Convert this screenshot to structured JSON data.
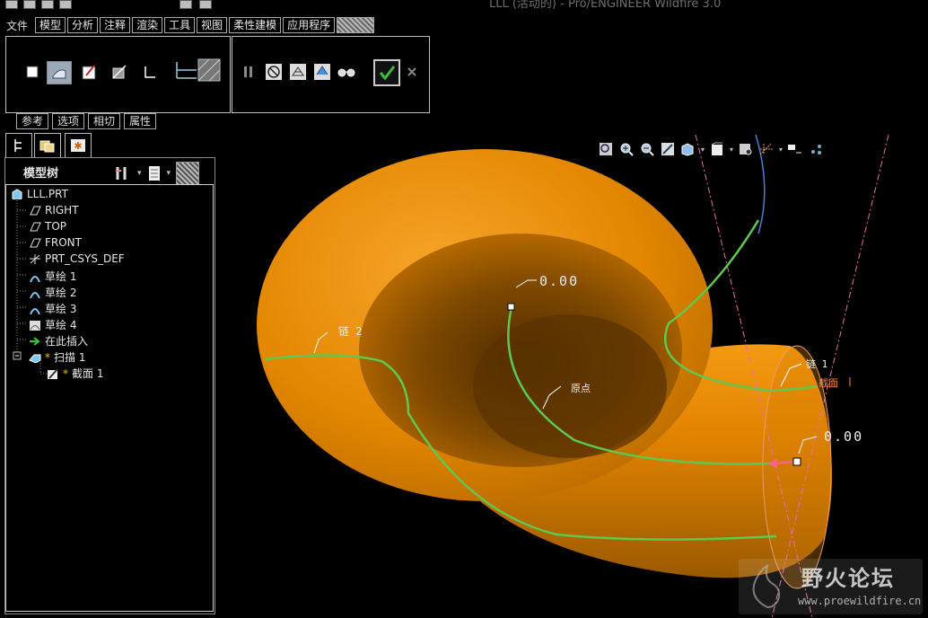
{
  "window": {
    "title_fragment": "LLL (活动的) - Pro/ENGINEER Wildfire 3.0"
  },
  "menu": {
    "file": "文件",
    "items": [
      "模型",
      "分析",
      "注释",
      "渲染",
      "工具",
      "视图",
      "柔性建模",
      "应用程序"
    ]
  },
  "dashboard": {
    "tabs": [
      "参考",
      "选项",
      "相切",
      "属性"
    ],
    "left_icons": [
      "solid-icon",
      "surface-icon",
      "sketch-icon",
      "remove-material-icon",
      "thin-icon",
      "section-trajectory-icon"
    ],
    "right_icons": [
      "pause-icon",
      "no-preview-icon",
      "geometry-preview-icon",
      "verify-icon",
      "glasses-icon",
      "confirm-check-icon",
      "cancel-x-icon"
    ]
  },
  "panel": {
    "header": "模型树",
    "tree": [
      {
        "label": "LLL.PRT",
        "icon": "part-icon",
        "level": 0
      },
      {
        "label": "RIGHT",
        "icon": "datum-plane-icon",
        "level": 1
      },
      {
        "label": "TOP",
        "icon": "datum-plane-icon",
        "level": 1
      },
      {
        "label": "FRONT",
        "icon": "datum-plane-icon",
        "level": 1
      },
      {
        "label": "PRT_CSYS_DEF",
        "icon": "csys-icon",
        "level": 1
      },
      {
        "label": "草绘 1",
        "icon": "sketch-feature-icon",
        "level": 1
      },
      {
        "label": "草绘 2",
        "icon": "sketch-feature-icon",
        "level": 1
      },
      {
        "label": "草绘 3",
        "icon": "sketch-feature-icon",
        "level": 1
      },
      {
        "label": "草绘 4",
        "icon": "sketch-feature-icon",
        "level": 1
      },
      {
        "label": "在此插入",
        "icon": "insert-here-icon",
        "level": 1
      },
      {
        "label": "扫描 1",
        "icon": "sweep-icon",
        "level": 1,
        "expanded": true,
        "marker": "*"
      },
      {
        "label": "截面 1",
        "icon": "section-icon",
        "level": 2,
        "marker": "*"
      }
    ]
  },
  "viewport": {
    "annotations": {
      "chain2": "链 2",
      "chain1": "链 1",
      "origin": "原点",
      "section": "截面",
      "value_top": "0.00",
      "value_right": "0.00"
    },
    "colors": {
      "body": "#e38600",
      "curve": "#5ec84f",
      "datum": "#e76fa8",
      "selected": "#ff5fa0"
    }
  },
  "watermark": {
    "cn": "野火论坛",
    "url": "www.proewildfire.cn"
  }
}
